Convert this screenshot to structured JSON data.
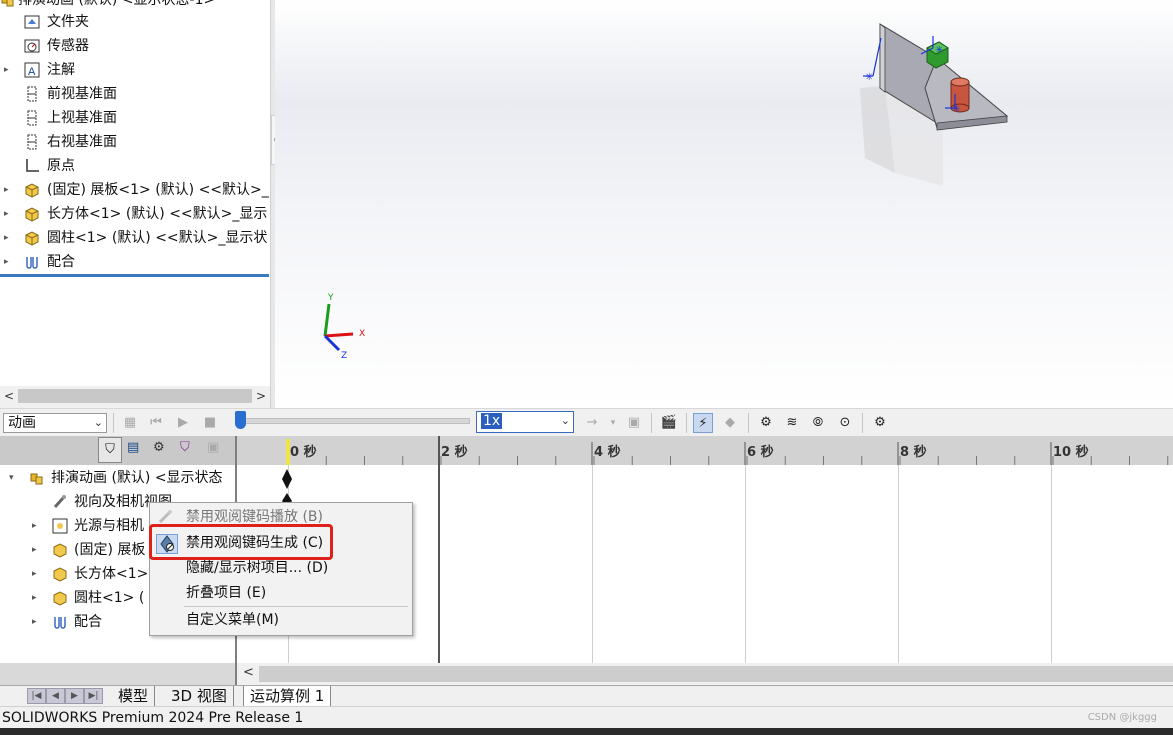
{
  "feature_tree": {
    "items": [
      {
        "label": "排演动画 (默认) <显示状态-1>",
        "icon": "assembly-icon",
        "expander": ""
      },
      {
        "label": "文件夹",
        "icon": "folder-icon",
        "expander": ""
      },
      {
        "label": "传感器",
        "icon": "sensor-icon",
        "expander": ""
      },
      {
        "label": "注解",
        "icon": "annotation-icon",
        "expander": "▸"
      },
      {
        "label": "前视基准面",
        "icon": "plane-icon",
        "expander": ""
      },
      {
        "label": "上视基准面",
        "icon": "plane-icon",
        "expander": ""
      },
      {
        "label": "右视基准面",
        "icon": "plane-icon",
        "expander": ""
      },
      {
        "label": "原点",
        "icon": "origin-icon",
        "expander": ""
      },
      {
        "label": "(固定) 展板<1> (默认) <<默认>_",
        "icon": "part-icon",
        "expander": "▸"
      },
      {
        "label": "长方体<1> (默认) <<默认>_显示",
        "icon": "part-icon",
        "expander": "▸"
      },
      {
        "label": "圆柱<1> (默认) <<默认>_显示状",
        "icon": "part-icon",
        "expander": "▸"
      },
      {
        "label": "配合",
        "icon": "mates-icon",
        "expander": "▸"
      }
    ]
  },
  "motion_toolbar": {
    "study_type": "动画",
    "playback_speed": "1x",
    "colors": {
      "slider_knob": "#2a6fd0"
    }
  },
  "motion_tree": {
    "items": [
      {
        "label": "排演动画 (默认) <显示状态",
        "icon": "assembly-icon",
        "expander": "▾"
      },
      {
        "label": "视向及相机视图",
        "icon": "camera-view-icon",
        "expander": ""
      },
      {
        "label": "光源与相机",
        "icon": "lights-icon",
        "expander": "▸"
      },
      {
        "label": "(固定) 展板",
        "icon": "part-icon",
        "expander": "▸"
      },
      {
        "label": "长方体<1>",
        "icon": "part-icon",
        "expander": "▸"
      },
      {
        "label": "圆柱<1> (",
        "icon": "part-icon",
        "expander": "▸"
      },
      {
        "label": "配合",
        "icon": "mates-icon",
        "expander": "▸"
      }
    ]
  },
  "timeline": {
    "ticks": [
      "0 秒",
      "2 秒",
      "4 秒",
      "6 秒",
      "8 秒",
      "10 秒"
    ]
  },
  "context_menu": {
    "items": [
      {
        "label": "禁用观阅键码播放 (B)",
        "enabled": false,
        "icon": "key-playback-icon"
      },
      {
        "label": "禁用观阅键码生成 (C)",
        "enabled": true,
        "icon": "key-generate-icon",
        "highlighted": true
      },
      {
        "label": "隐藏/显示树项目... (D)",
        "enabled": true
      },
      {
        "label": "折叠项目 (E)",
        "enabled": true
      },
      {
        "label": "自定义菜单(M)",
        "enabled": true
      }
    ],
    "highlight_color": "#e0211b"
  },
  "tabs": [
    {
      "label": "模型",
      "active": false
    },
    {
      "label": "3D 视图",
      "active": false
    },
    {
      "label": "运动算例 1",
      "active": true
    }
  ],
  "status_bar": {
    "text": "SOLIDWORKS Premium 2024 Pre Release 1"
  },
  "watermark": "CSDN @jkggg",
  "triad": {
    "x": "X",
    "y": "Y",
    "z": "Z"
  }
}
